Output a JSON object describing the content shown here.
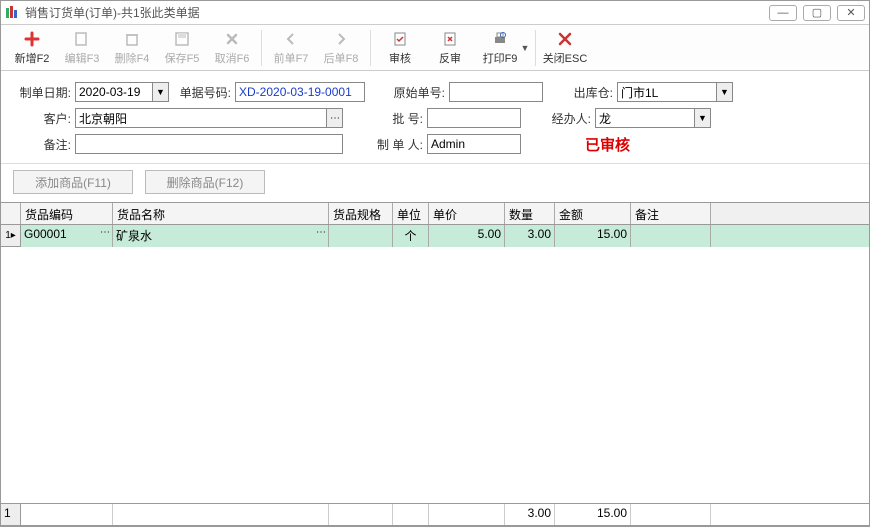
{
  "title": "销售订货单(订单)-共1张此类单据",
  "toolbar": {
    "new": "新增F2",
    "edit": "编辑F3",
    "delete": "删除F4",
    "save": "保存F5",
    "cancel": "取消F6",
    "prev": "前单F7",
    "next": "后单F8",
    "audit": "审核",
    "unaudit": "反审",
    "print": "打印F9",
    "close": "关闭ESC"
  },
  "form": {
    "date_lbl": "制单日期:",
    "date_val": "2020-03-19",
    "docno_lbl": "单据号码:",
    "docno_val": "XD-2020-03-19-0001",
    "orig_lbl": "原始单号:",
    "orig_val": "",
    "wh_lbl": "出库仓:",
    "wh_val": "门市1L",
    "cust_lbl": "客户:",
    "cust_val": "北京朝阳",
    "batch_lbl": "批    号:",
    "batch_val": "",
    "handler_lbl": "经办人:",
    "handler_val": "龙",
    "note_lbl": "备注:",
    "note_val": "",
    "maker_lbl": "制 单 人:",
    "maker_val": "Admin",
    "status": "已审核"
  },
  "buttons": {
    "add_item": "添加商品(F11)",
    "del_item": "删除商品(F12)"
  },
  "grid": {
    "headers": {
      "code": "货品编码",
      "name": "货品名称",
      "spec": "货品规格",
      "unit": "单位",
      "price": "单价",
      "qty": "数量",
      "amt": "金额",
      "note": "备注"
    },
    "row": {
      "idx": "1",
      "code": "G00001",
      "name": "矿泉水",
      "spec": "",
      "unit": "个",
      "price": "5.00",
      "qty": "3.00",
      "amt": "15.00",
      "note": ""
    },
    "footer": {
      "idx": "1",
      "qty": "3.00",
      "amt": "15.00"
    }
  }
}
